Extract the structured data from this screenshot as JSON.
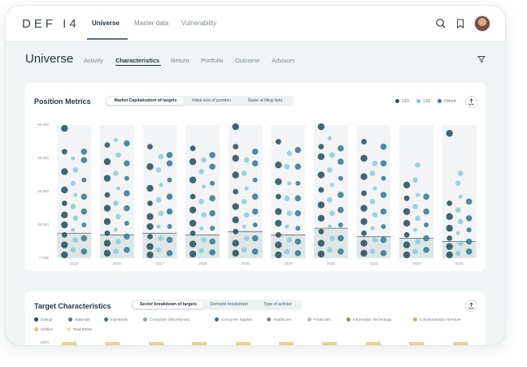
{
  "app": {
    "logo": "DEF I4"
  },
  "nav": [
    {
      "label": "Universe",
      "active": true
    },
    {
      "label": "Master data",
      "active": false
    },
    {
      "label": "Vulnerability",
      "active": false
    }
  ],
  "header_icons": [
    "search-icon",
    "bookmark-icon",
    "avatar"
  ],
  "page": {
    "title": "Universe",
    "subtabs": [
      {
        "label": "Activity",
        "active": false
      },
      {
        "label": "Characteristics",
        "active": true
      },
      {
        "label": "Return",
        "active": false
      },
      {
        "label": "Portfolio",
        "active": false
      },
      {
        "label": "Outcome",
        "active": false
      },
      {
        "label": "Advisors",
        "active": false
      }
    ]
  },
  "position_metrics": {
    "title": "Position Metrics",
    "segments": [
      {
        "label": "Market Capitalization of targets",
        "active": true
      },
      {
        "label": "Initial size of position",
        "active": false
      },
      {
        "label": "Stake at filing date",
        "active": false
      }
    ],
    "legend": [
      {
        "label": "13D",
        "color": "#2e5563"
      },
      {
        "label": "13G",
        "color": "#7cc6d8"
      },
      {
        "label": "Hybrid",
        "color": "#3f7d96"
      }
    ]
  },
  "chart_data": {
    "type": "scatter",
    "title": "Position Metrics",
    "ylim": [
      0,
      80000
    ],
    "yticks": [
      "0.00B",
      "20,000",
      "40,000",
      "60,000",
      "80,000"
    ],
    "categories": [
      "2015",
      "2016",
      "2017",
      "2018",
      "2019",
      "2020",
      "2021",
      "2022",
      "2023",
      "2024"
    ],
    "series": [
      {
        "name": "13D",
        "color": "#2e5563",
        "values": [
          [
            2000,
            8000,
            14000,
            20000,
            26000,
            33000,
            41000,
            52000,
            64000,
            78000
          ],
          [
            3000,
            9000,
            15000,
            22000,
            30000,
            38000,
            48000,
            58000,
            68000
          ],
          [
            2000,
            7000,
            13000,
            19000,
            25000,
            33000,
            42000,
            55000,
            67000
          ],
          [
            2500,
            8500,
            15000,
            21000,
            29000,
            37000,
            47000,
            58000,
            66000
          ],
          [
            3000,
            9000,
            16000,
            23000,
            31000,
            40000,
            50000,
            60000,
            67000,
            79000
          ],
          [
            2000,
            8000,
            14000,
            21000,
            28000,
            37000,
            46000,
            56000,
            70000
          ],
          [
            2500,
            9000,
            16000,
            24000,
            32000,
            41000,
            50000,
            61000,
            67000,
            79000
          ],
          [
            3000,
            9000,
            15000,
            22000,
            30000,
            39000,
            49000,
            60000,
            70000
          ],
          [
            2000,
            8000,
            14000,
            21000,
            28000,
            36000,
            44000
          ],
          [
            2000,
            7000,
            12000,
            18000,
            25000,
            33000,
            75000
          ]
        ]
      },
      {
        "name": "13G",
        "color": "#7cc6d8",
        "values": [
          [
            5000,
            11000,
            17000,
            24000,
            31000,
            38000,
            45000,
            53000,
            60000
          ],
          [
            4000,
            10000,
            17000,
            25000,
            33000,
            42000,
            51000,
            62000,
            71000
          ],
          [
            5000,
            12000,
            19000,
            27000,
            35000,
            44000,
            53000,
            61000
          ],
          [
            4500,
            11000,
            18000,
            26000,
            34000,
            43000,
            52000,
            59000
          ],
          [
            5000,
            12000,
            19000,
            26000,
            34000,
            42000,
            51000,
            59000
          ],
          [
            4000,
            11000,
            19000,
            27000,
            36000,
            45000,
            55000,
            63000
          ],
          [
            5000,
            12000,
            19000,
            27000,
            35000,
            44000,
            53000,
            62000,
            72000
          ],
          [
            4000,
            11000,
            18000,
            26000,
            34000,
            42000,
            51000,
            57000
          ],
          [
            4000,
            10000,
            17000,
            24000,
            31000,
            38000,
            47000,
            56000
          ],
          [
            3000,
            9000,
            15000,
            22000,
            29000,
            37000,
            45000,
            51000
          ]
        ]
      },
      {
        "name": "Hybrid",
        "color": "#3f7d96",
        "values": [
          [
            4000,
            12000,
            20000,
            28000,
            37000,
            47000,
            59000,
            64000
          ],
          [
            5000,
            13000,
            21000,
            30000,
            39000,
            48000,
            57000,
            69000
          ],
          [
            3000,
            11000,
            19000,
            28000,
            37000,
            47000,
            57000,
            62000
          ],
          [
            3500,
            10000,
            18000,
            27000,
            36000,
            45000,
            55000,
            62000
          ],
          [
            4000,
            12000,
            20000,
            28000,
            37000,
            47000,
            57000,
            64000
          ],
          [
            3000,
            10000,
            18000,
            27000,
            36000,
            45000,
            55000,
            65000
          ],
          [
            4000,
            12000,
            20000,
            29000,
            38000,
            48000,
            58000,
            66000
          ],
          [
            3000,
            11000,
            19000,
            28000,
            38000,
            48000,
            57000,
            67000
          ],
          [
            5000,
            12000,
            20000,
            28000,
            37000
          ],
          [
            4000,
            10000,
            17000,
            24000,
            34000
          ]
        ]
      }
    ],
    "medians": [
      15000,
      14000,
      15000,
      14000,
      16000,
      14000,
      18000,
      13000,
      12000,
      10000
    ],
    "legend_position": "top-right",
    "grid": false
  },
  "target_characteristics": {
    "title": "Target Characteristics",
    "segments": [
      {
        "label": "Sector breakdown of targets",
        "active": true
      },
      {
        "label": "Demand breakdown",
        "active": false
      },
      {
        "label": "Type of activist",
        "active": false
      }
    ],
    "legend": [
      {
        "label": "Energy",
        "color": "#2e4550"
      },
      {
        "label": "Materials",
        "color": "#4b7a86"
      },
      {
        "label": "Industrials",
        "color": "#3a6f82"
      },
      {
        "label": "Consumer Discretionary",
        "color": "#7fa9b3"
      },
      {
        "label": "Consumer Staples",
        "color": "#3b6a8e"
      },
      {
        "label": "Healthcare",
        "color": "#6f8f94"
      },
      {
        "label": "Financials",
        "color": "#b9c2a8"
      },
      {
        "label": "Information Technology",
        "color": "#9c8a63"
      },
      {
        "label": "Communication Services",
        "color": "#d1b064"
      },
      {
        "label": "Utilities",
        "color": "#e3c777"
      },
      {
        "label": "Real Estate",
        "color": "#efe0aa"
      }
    ],
    "y_top_label": "100%"
  }
}
